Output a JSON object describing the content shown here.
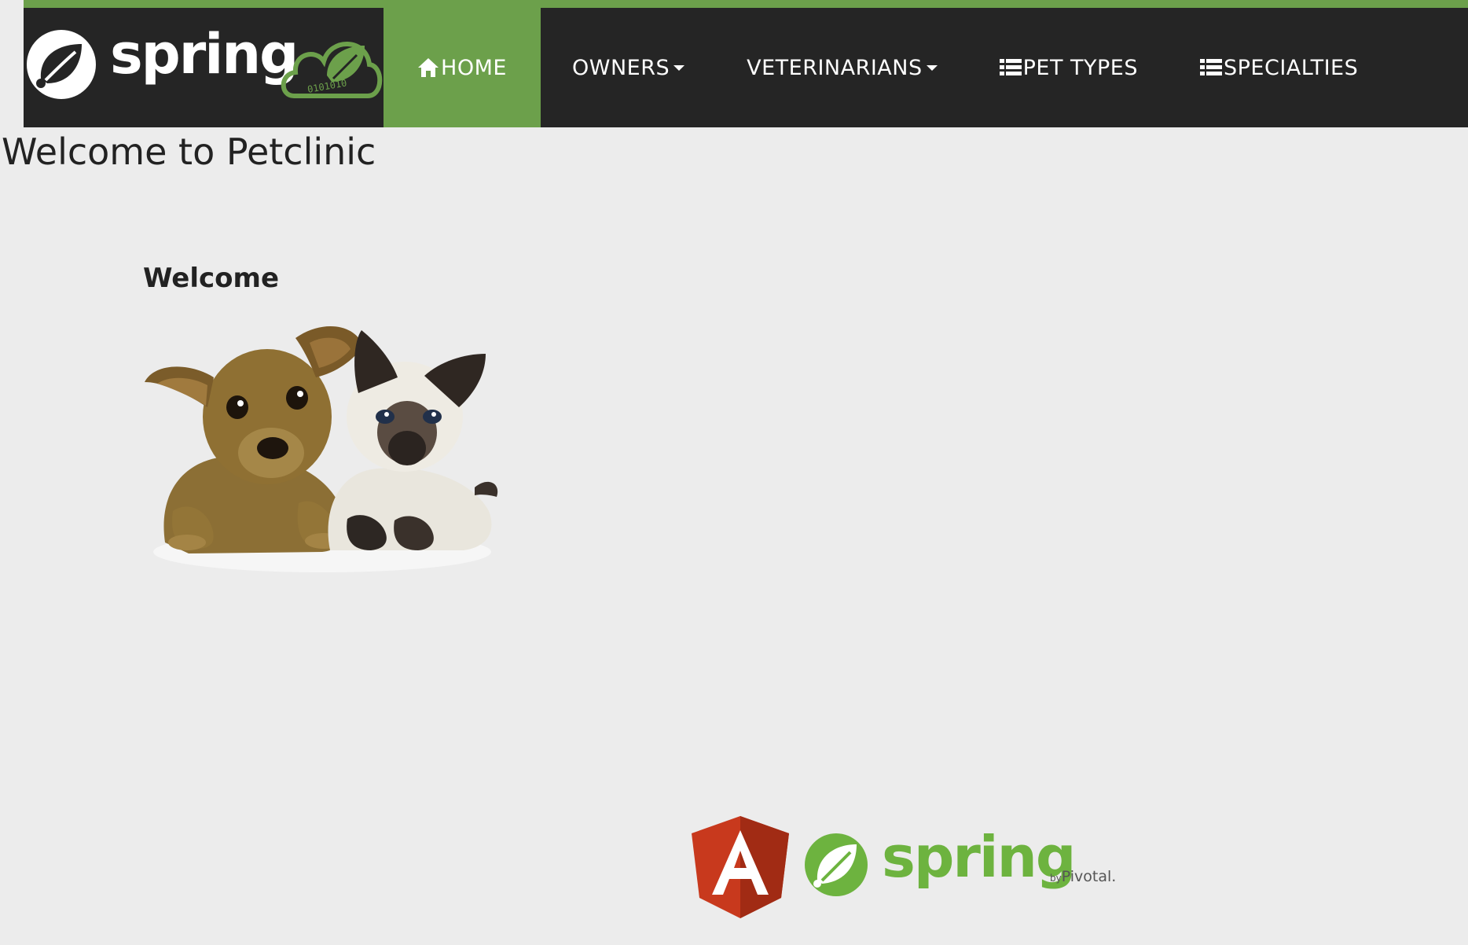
{
  "brand": {
    "name": "spring",
    "cloud_digits": "0101010"
  },
  "nav": {
    "items": [
      {
        "label": "HOME",
        "icon": "home-icon",
        "active": true
      },
      {
        "label": "OWNERS",
        "dropdown": true
      },
      {
        "label": "VETERINARIANS",
        "dropdown": true
      },
      {
        "label": "PET TYPES",
        "icon": "list-icon"
      },
      {
        "label": "SPECIALTIES",
        "icon": "list-icon"
      }
    ]
  },
  "main": {
    "title": "Welcome to Petclinic",
    "section_title": "Welcome"
  },
  "footer": {
    "angular_letter": "A",
    "spring_word": "spring",
    "by": "by",
    "pivotal": "Pivotal."
  },
  "colors": {
    "accent_green": "#6ca04b",
    "navbar_bg": "#252525",
    "page_bg": "#ececec",
    "spring_green": "#6db33f",
    "angular_red": "#c3002f"
  }
}
